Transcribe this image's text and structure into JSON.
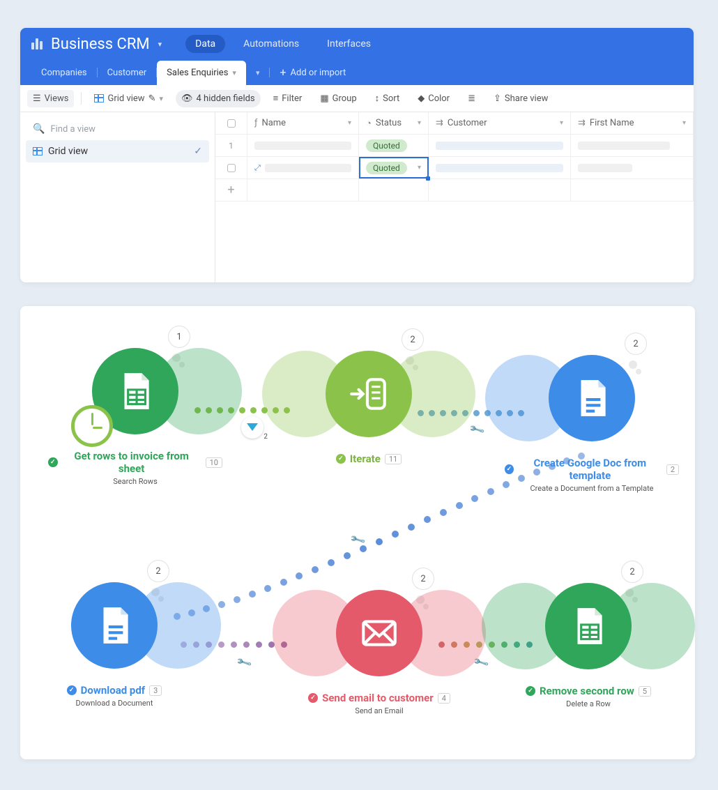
{
  "header": {
    "base_name": "Business CRM",
    "nav": [
      {
        "label": "Data",
        "active": true
      },
      {
        "label": "Automations",
        "active": false
      },
      {
        "label": "Interfaces",
        "active": false
      }
    ]
  },
  "tables": {
    "items": [
      "Companies",
      "Customer",
      "Sales Enquiries"
    ],
    "active_index": 2,
    "add": "Add or import"
  },
  "toolbar": {
    "views": "Views",
    "grid_view": "Grid view",
    "hidden_fields": "4 hidden fields",
    "filter": "Filter",
    "group": "Group",
    "sort": "Sort",
    "color": "Color",
    "share": "Share view"
  },
  "sidebar": {
    "find_placeholder": "Find a view",
    "grid_view": "Grid view"
  },
  "columns": {
    "name": "Name",
    "status": "Status",
    "customer": "Customer",
    "first_name": "First Name"
  },
  "rows": [
    {
      "num": "1",
      "status": "Quoted"
    },
    {
      "num": "",
      "status": "Quoted"
    }
  ],
  "flow": {
    "nodes": [
      {
        "id": "get_rows",
        "title": "Get rows to invoice from sheet",
        "sub": "Search Rows",
        "count": "10",
        "badge": "1",
        "color": "green"
      },
      {
        "id": "iterate",
        "title": "Iterate",
        "sub": "",
        "count": "11",
        "badge": "2",
        "color": "lgreen"
      },
      {
        "id": "create_doc",
        "title": "Create Google Doc from template",
        "sub": "Create a Document from a Template",
        "count": "2",
        "badge": "2",
        "color": "blue"
      },
      {
        "id": "download",
        "title": "Download pdf",
        "sub": "Download a Document",
        "count": "3",
        "badge": "2",
        "color": "blue"
      },
      {
        "id": "send_email",
        "title": "Send email to customer",
        "sub": "Send an Email",
        "count": "4",
        "badge": "2",
        "color": "red"
      },
      {
        "id": "remove_row",
        "title": "Remove second row",
        "sub": "Delete a Row",
        "count": "5",
        "badge": "2",
        "color": "green"
      }
    ],
    "filter_badge": "2"
  }
}
